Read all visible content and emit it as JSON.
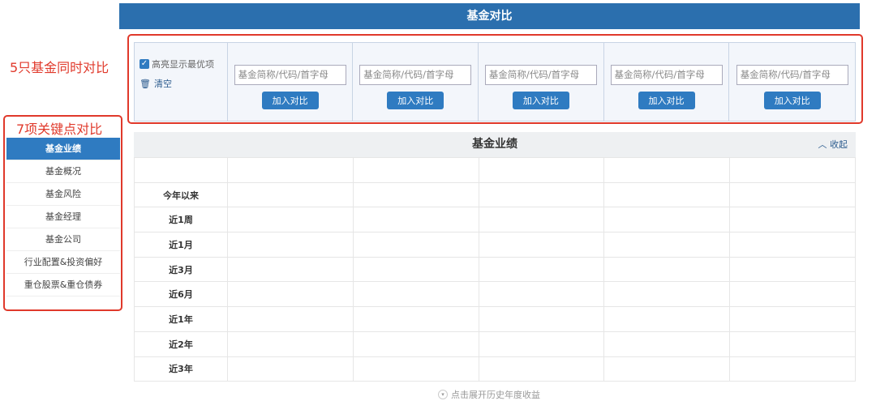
{
  "header": {
    "title": "基金对比"
  },
  "annotations": {
    "funds": "5只基金同时对比",
    "points": "7项关键点对比"
  },
  "controls": {
    "highlight_label": "高亮显示最优项",
    "highlight_checked": true,
    "clear_label": "清空"
  },
  "fund_slots": [
    {
      "placeholder": "基金简称/代码/首字母",
      "button": "加入对比"
    },
    {
      "placeholder": "基金简称/代码/首字母",
      "button": "加入对比"
    },
    {
      "placeholder": "基金简称/代码/首字母",
      "button": "加入对比"
    },
    {
      "placeholder": "基金简称/代码/首字母",
      "button": "加入对比"
    },
    {
      "placeholder": "基金简称/代码/首字母",
      "button": "加入对比"
    }
  ],
  "sidebar": {
    "items": [
      "基金业绩",
      "基金概况",
      "基金风险",
      "基金经理",
      "基金公司",
      "行业配置&投资偏好",
      "重仓股票&重仓债券"
    ],
    "active": 0
  },
  "section": {
    "title": "基金业绩",
    "collapse": "收起"
  },
  "table": {
    "rows": [
      "",
      "今年以来",
      "近1周",
      "近1月",
      "近3月",
      "近6月",
      "近1年",
      "近2年",
      "近3年"
    ]
  },
  "footer": {
    "expand": "点击展开历史年度收益"
  }
}
